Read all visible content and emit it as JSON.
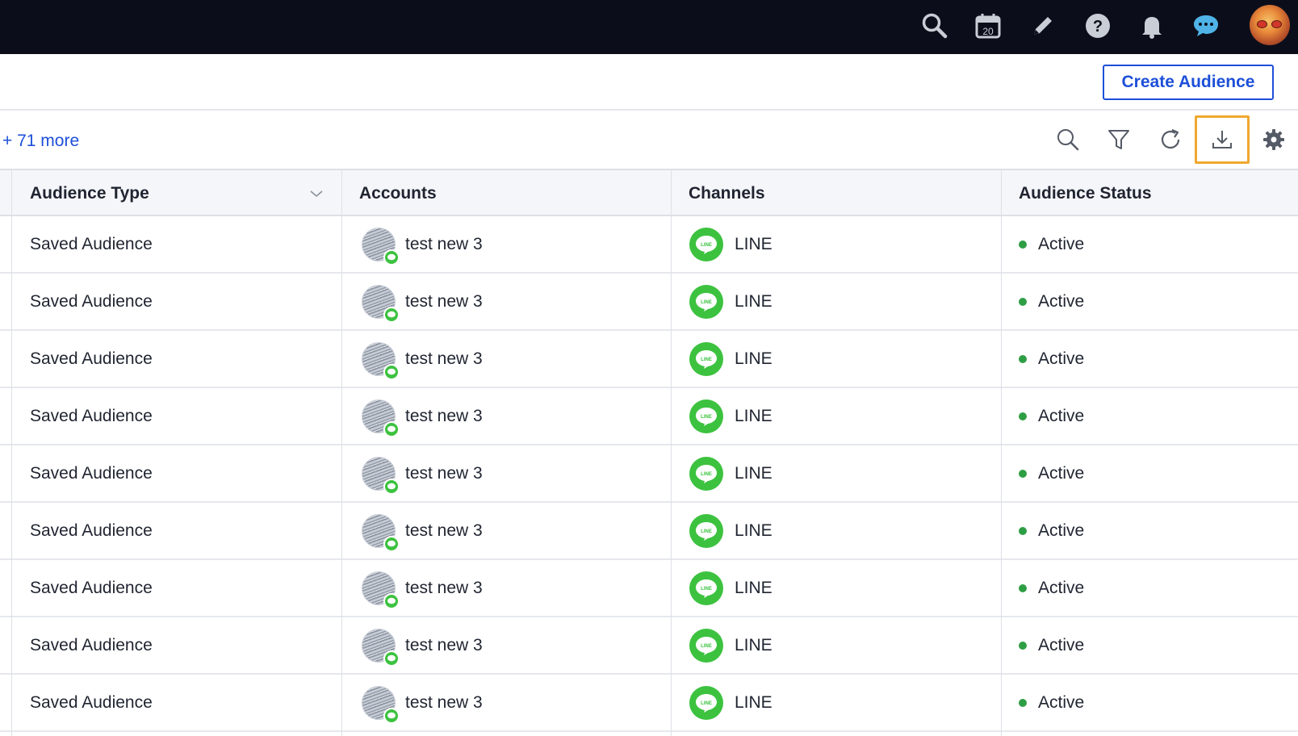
{
  "topbar": {
    "icons": [
      "search-icon",
      "calendar-icon",
      "pencil-icon",
      "help-icon",
      "bell-icon",
      "chat-icon"
    ],
    "calendar_day": "20"
  },
  "header": {
    "create_button_label": "Create Audience"
  },
  "toolbar": {
    "more_link": "+ 71 more",
    "tools": [
      "search-icon",
      "filter-icon",
      "refresh-icon",
      "download-icon",
      "gear-icon"
    ]
  },
  "table": {
    "columns": [
      "Audience Type",
      "Accounts",
      "Channels",
      "Audience Status"
    ],
    "rows": [
      {
        "type": "Saved Audience",
        "account": "test new 3",
        "channel": "LINE",
        "status": "Active"
      },
      {
        "type": "Saved Audience",
        "account": "test new 3",
        "channel": "LINE",
        "status": "Active"
      },
      {
        "type": "Saved Audience",
        "account": "test new 3",
        "channel": "LINE",
        "status": "Active"
      },
      {
        "type": "Saved Audience",
        "account": "test new 3",
        "channel": "LINE",
        "status": "Active"
      },
      {
        "type": "Saved Audience",
        "account": "test new 3",
        "channel": "LINE",
        "status": "Active"
      },
      {
        "type": "Saved Audience",
        "account": "test new 3",
        "channel": "LINE",
        "status": "Active"
      },
      {
        "type": "Saved Audience",
        "account": "test new 3",
        "channel": "LINE",
        "status": "Active"
      },
      {
        "type": "Saved Audience",
        "account": "test new 3",
        "channel": "LINE",
        "status": "Active"
      },
      {
        "type": "Saved Audience",
        "account": "test new 3",
        "channel": "LINE",
        "status": "Active"
      }
    ]
  },
  "colors": {
    "topbar_bg": "#0b0e1a",
    "accent_blue": "#1d4fd8",
    "highlight": "#f0a830",
    "line_green": "#3cc23f",
    "status_active": "#2e9e45",
    "chat_icon": "#4fb3e8"
  }
}
